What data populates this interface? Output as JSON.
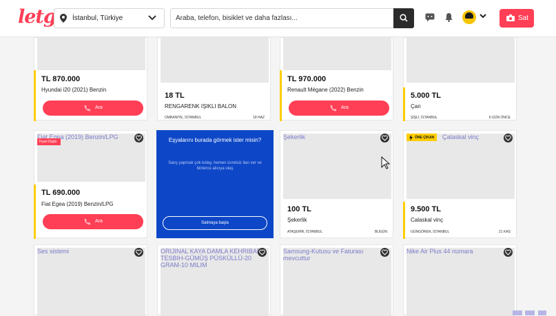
{
  "header": {
    "logo": "letgo",
    "location": "İstanbul, Türkiye",
    "search_placeholder": "Araba, telefon, bisiklet ve daha fazlası...",
    "sell_label": "Sat"
  },
  "icons": {
    "location": "location-pin-icon",
    "search": "search-icon",
    "chat": "chat-icon",
    "bell": "bell-icon",
    "camera": "camera-icon",
    "heart": "heart-icon",
    "phone": "phone-icon",
    "bolt": "lightning-icon"
  },
  "colors": {
    "brand": "#ff3f55",
    "accent_yellow": "#ffcd00",
    "promo_blue": "#0d47c7"
  },
  "listings_row1": [
    {
      "price": "TL 870.000",
      "title": "Hyundai i20 (2021) Benzin",
      "call": "Ara"
    },
    {
      "price": "18 TL",
      "title": "RENGARENK IŞIKLI BALON",
      "location": "ÜMRANİYE, İSTANBUL",
      "date": "18 HAZ"
    },
    {
      "price": "TL 970.000",
      "title": "Renault Mégane (2022) Benzin",
      "call": "Ara"
    },
    {
      "price": "5.000 TL",
      "title": "Çan",
      "location": "ŞİŞLİ, İSTANBUL",
      "date": "6 GÜN ÖNCE"
    }
  ],
  "listings_row2": [
    {
      "image_alt": "Fiat Egea (2019) Benzin/LPG",
      "tag": "Fiyat Düştü",
      "price": "TL 690.000",
      "title": "Fiat Egea (2019) Benzin/LPG",
      "call": "Ara"
    },
    {
      "image_alt": "Şekerlik",
      "price": "100 TL",
      "title": "Şekerlik",
      "location": "ATAŞEHİR, İSTANBUL",
      "date": "BUGÜN"
    },
    {
      "image_alt": "Çalaskal vinç",
      "badge": "ÖNE ÇIKAN",
      "price": "9.500 TL",
      "title": "Calaskal vinç",
      "location": "GÜNGÖREN, İSTANBUL",
      "date": "21 KAS"
    }
  ],
  "promo": {
    "title": "Eşyalarını burada görmek ister misin?",
    "text": "Satış yapmak çok kolay, hemen ücretsiz ilan ver ve binlerce alıcıya ulaş",
    "button": "Satmaya başla"
  },
  "listings_row3": [
    {
      "image_alt": "Ses sistemi"
    },
    {
      "image_alt": "ORIJINAL KAYA DAMLA KEHRIBAR TESBIH-GÜMÜŞ PÜSKÜLLÜ-20 GRAM-10 MILIM"
    },
    {
      "image_alt": "Samsung-Kutusu ve Faturası mevcuttur"
    },
    {
      "image_alt": "Nike Air Plus 44 numara"
    }
  ]
}
